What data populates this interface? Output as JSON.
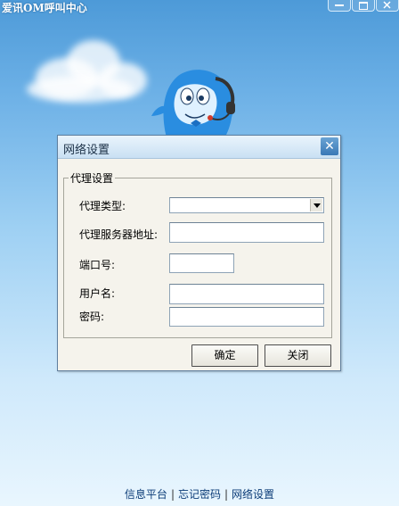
{
  "window": {
    "title": "爱讯OM呼叫中心",
    "controls": {
      "minimize_icon": "minimize-icon",
      "maximize_icon": "maximize-icon",
      "close_icon": "close-icon"
    }
  },
  "dialog": {
    "title": "网络设置",
    "close_glyph": "✕",
    "proxy_group": {
      "legend": "代理设置",
      "proxy_type": {
        "label": "代理类型:",
        "selected": ""
      },
      "proxy_server": {
        "label": "代理服务器地址:",
        "value": ""
      },
      "port": {
        "label": "端口号:",
        "value": ""
      },
      "username": {
        "label": "用户名:",
        "value": ""
      },
      "password": {
        "label": "密码:",
        "value": ""
      }
    },
    "buttons": {
      "ok": "确定",
      "close": "关闭"
    }
  },
  "footer": {
    "links": [
      "信息平台",
      "忘记密码",
      "网络设置"
    ],
    "separator": "|"
  },
  "colors": {
    "accent": "#3a79b6",
    "dialog_bg": "#f5f3ec",
    "link": "#0d3d78"
  }
}
